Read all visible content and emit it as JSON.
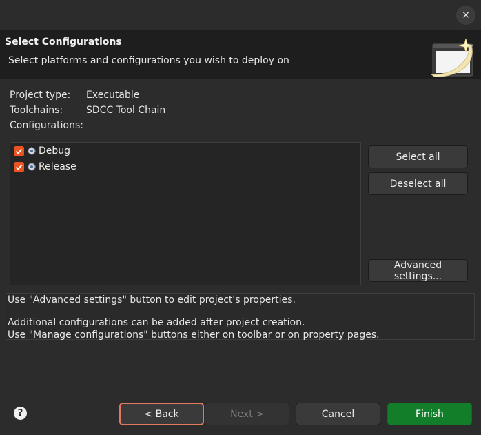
{
  "window": {
    "close_glyph": "×"
  },
  "header": {
    "title": "Select Configurations",
    "subtitle": "Select platforms and configurations you wish to deploy on",
    "icon": "wizard-banner-icon"
  },
  "info": {
    "project_type_label": "Project type:",
    "project_type_value": "Executable",
    "toolchains_label": "Toolchains:",
    "toolchains_value": "SDCC Tool Chain",
    "configurations_label": "Configurations:"
  },
  "configurations": [
    {
      "label": "Debug",
      "checked": true,
      "icon": "gear-icon"
    },
    {
      "label": "Release",
      "checked": true,
      "icon": "gear-icon"
    }
  ],
  "side_buttons": {
    "select_all": "Select all",
    "deselect_all": "Deselect all",
    "advanced": "Advanced settings..."
  },
  "messages": {
    "line1": "Use \"Advanced settings\" button to edit project's properties.",
    "line2": "Additional configurations can be added after project creation.",
    "line3": "Use \"Manage configurations\" buttons either on toolbar or on property pages."
  },
  "footer": {
    "help_glyph": "?",
    "back_prefix": "< ",
    "back_mnemonic": "B",
    "back_rest": "ack",
    "next": "Next >",
    "cancel": "Cancel",
    "finish_mnemonic": "F",
    "finish_rest": "inish"
  },
  "colors": {
    "accent_checkbox": "#e95420",
    "finish_button": "#137e2a",
    "focus_border": "#e07a5f",
    "header_bg": "#1e1e1e"
  }
}
